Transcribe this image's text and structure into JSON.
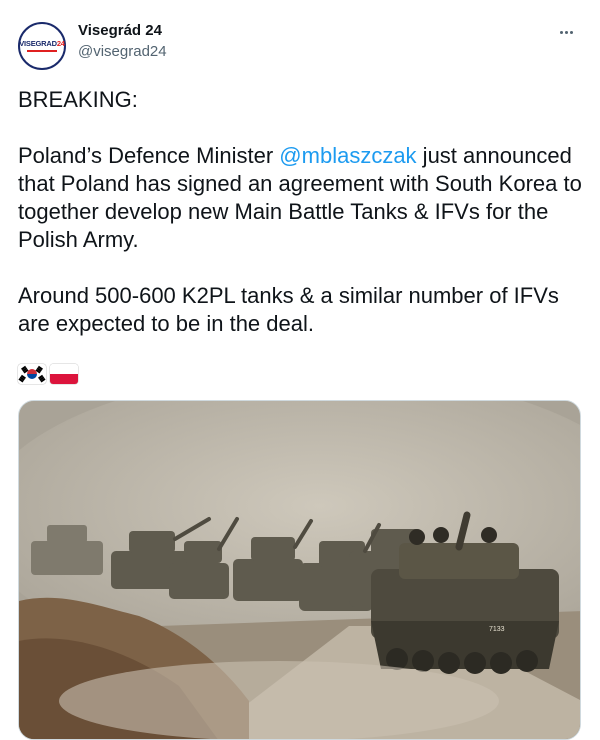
{
  "author": {
    "display_name": "Visegrád 24",
    "handle": "@visegrad24",
    "avatar_text": "VISEGRAD",
    "avatar_number": "24"
  },
  "more_icon": "ellipsis-icon",
  "tweet": {
    "p1": "BREAKING:",
    "p2_before": "Poland’s Defence Minister ",
    "p2_mention": "@mblaszczak",
    "p2_after": " just announced that Poland has signed an agreement with South Korea to together develop new Main Battle Tanks & IFVs for the Polish Army.",
    "p3": "Around 500-600 K2PL tanks & a similar number of IFVs are expected to be in the deal."
  },
  "flags": [
    "south-korea-flag",
    "poland-flag"
  ],
  "media": {
    "icon": "photo-tanks-column",
    "tank_marking": "7133"
  },
  "colors": {
    "link": "#1d9bf0",
    "secondary_text": "#536471",
    "text": "#0f1419"
  }
}
